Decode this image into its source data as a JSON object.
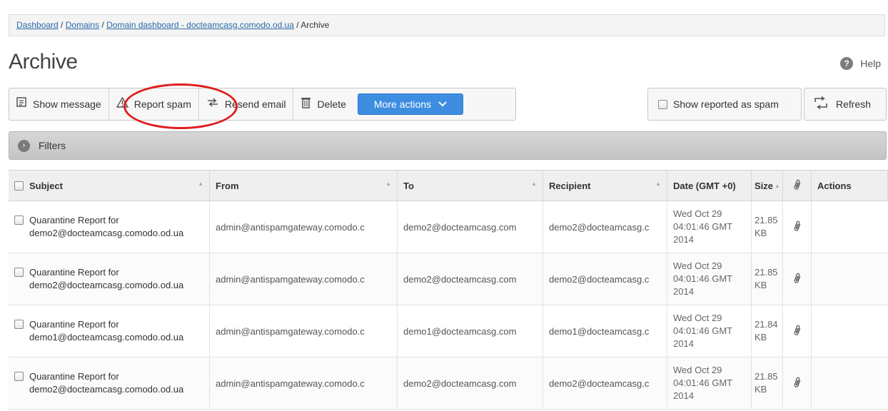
{
  "breadcrumb": {
    "dashboard": "Dashboard",
    "sep1": " / ",
    "domains": "Domains",
    "sep2": " / ",
    "domain_dashboard": "Domain dashboard - docteamcasg.comodo.od.ua",
    "sep3": " / ",
    "current": "Archive"
  },
  "page": {
    "title": "Archive",
    "help": "Help"
  },
  "toolbar": {
    "show_message": "Show message",
    "report_spam": "Report spam",
    "resend_email": "Resend email",
    "delete": "Delete",
    "more_actions": "More actions"
  },
  "right_controls": {
    "show_reported": "Show reported as spam",
    "refresh": "Refresh"
  },
  "filters": {
    "label": "Filters"
  },
  "table": {
    "headers": {
      "subject": "Subject",
      "from": "From",
      "to": "To",
      "recipient": "Recipient",
      "date": "Date (GMT +0)",
      "size": "Size",
      "actions": "Actions"
    },
    "rows": [
      {
        "subject_line1": "Quarantine Report for",
        "subject_line2": "demo2@docteamcasg.comodo.od.ua",
        "from": "admin@antispamgateway.comodo.c",
        "to": "demo2@docteamcasg.com",
        "recipient": "demo2@docteamcasg.c",
        "date": "Wed Oct 29 04:01:46 GMT 2014",
        "size": "21.85 KB"
      },
      {
        "subject_line1": "Quarantine Report for",
        "subject_line2": "demo2@docteamcasg.comodo.od.ua",
        "from": "admin@antispamgateway.comodo.c",
        "to": "demo2@docteamcasg.com",
        "recipient": "demo2@docteamcasg.c",
        "date": "Wed Oct 29 04:01:46 GMT 2014",
        "size": "21.85 KB"
      },
      {
        "subject_line1": "Quarantine Report for",
        "subject_line2": "demo1@docteamcasg.comodo.od.ua",
        "from": "admin@antispamgateway.comodo.c",
        "to": "demo1@docteamcasg.com",
        "recipient": "demo1@docteamcasg.c",
        "date": "Wed Oct 29 04:01:46 GMT 2014",
        "size": "21.84 KB"
      },
      {
        "subject_line1": "Quarantine Report for",
        "subject_line2": "demo2@docteamcasg.comodo.od.ua",
        "from": "admin@antispamgateway.comodo.c",
        "to": "demo2@docteamcasg.com",
        "recipient": "demo2@docteamcasg.c",
        "date": "Wed Oct 29 04:01:46 GMT 2014",
        "size": "21.85 KB"
      }
    ]
  },
  "colors": {
    "accent": "#3d8ee0",
    "highlight_ellipse": "#e01e1e",
    "link": "#2a6aa8"
  }
}
